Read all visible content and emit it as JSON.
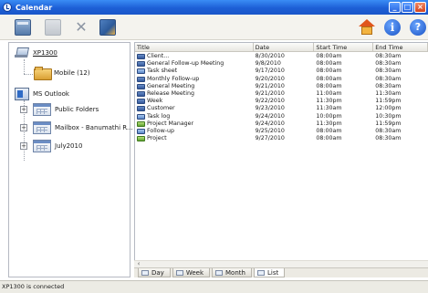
{
  "window": {
    "title": "Calendar"
  },
  "toolbar": {
    "icons": [
      "calendar-icon",
      "edit-icon",
      "delete-icon",
      "export-icon",
      "home-icon",
      "info-icon",
      "help-icon"
    ],
    "info_glyph": "i",
    "help_glyph": "?"
  },
  "tree": {
    "device": "XP1300",
    "mobile": "Mobile (12)",
    "ms_outlook": "MS Outlook",
    "folders": [
      "Public Folders",
      "Mailbox - Banumathi R...",
      "July2010"
    ]
  },
  "list": {
    "columns": [
      "Title",
      "Date",
      "Start Time",
      "End Time"
    ],
    "rows": [
      {
        "title": "Client...",
        "date": "8/30/2010",
        "start": "08:00am",
        "end": "08:30am",
        "icon": "appointment"
      },
      {
        "title": "General Follow-up Meeting",
        "date": "9/8/2010",
        "start": "08:00am",
        "end": "08:30am",
        "icon": "appointment"
      },
      {
        "title": "Task sheet",
        "date": "9/17/2010",
        "start": "08:00am",
        "end": "08:30am",
        "icon": "task"
      },
      {
        "title": "Monthly Follow-up",
        "date": "9/20/2010",
        "start": "08:00am",
        "end": "08:30am",
        "icon": "appointment"
      },
      {
        "title": "General Meeting",
        "date": "9/21/2010",
        "start": "08:00am",
        "end": "08:30am",
        "icon": "appointment"
      },
      {
        "title": "Release Meeting",
        "date": "9/21/2010",
        "start": "11:00am",
        "end": "11:30am",
        "icon": "appointment"
      },
      {
        "title": "Week",
        "date": "9/22/2010",
        "start": "11:30pm",
        "end": "11:59pm",
        "icon": "appointment"
      },
      {
        "title": "Customer",
        "date": "9/23/2010",
        "start": "11:30am",
        "end": "12:00pm",
        "icon": "appointment"
      },
      {
        "title": "Task log",
        "date": "9/24/2010",
        "start": "10:00pm",
        "end": "10:30pm",
        "icon": "task"
      },
      {
        "title": "Project Manager",
        "date": "9/24/2010",
        "start": "11:30pm",
        "end": "11:59pm",
        "icon": "plan"
      },
      {
        "title": "Follow-up",
        "date": "9/25/2010",
        "start": "08:00am",
        "end": "08:30am",
        "icon": "task"
      },
      {
        "title": "Project",
        "date": "9/27/2010",
        "start": "08:00am",
        "end": "08:30am",
        "icon": "plan"
      }
    ]
  },
  "tabs": [
    {
      "label": "Day",
      "active": false
    },
    {
      "label": "Week",
      "active": false
    },
    {
      "label": "Month",
      "active": false
    },
    {
      "label": "List",
      "active": true
    }
  ],
  "status": {
    "text": "XP1300 is connected"
  }
}
